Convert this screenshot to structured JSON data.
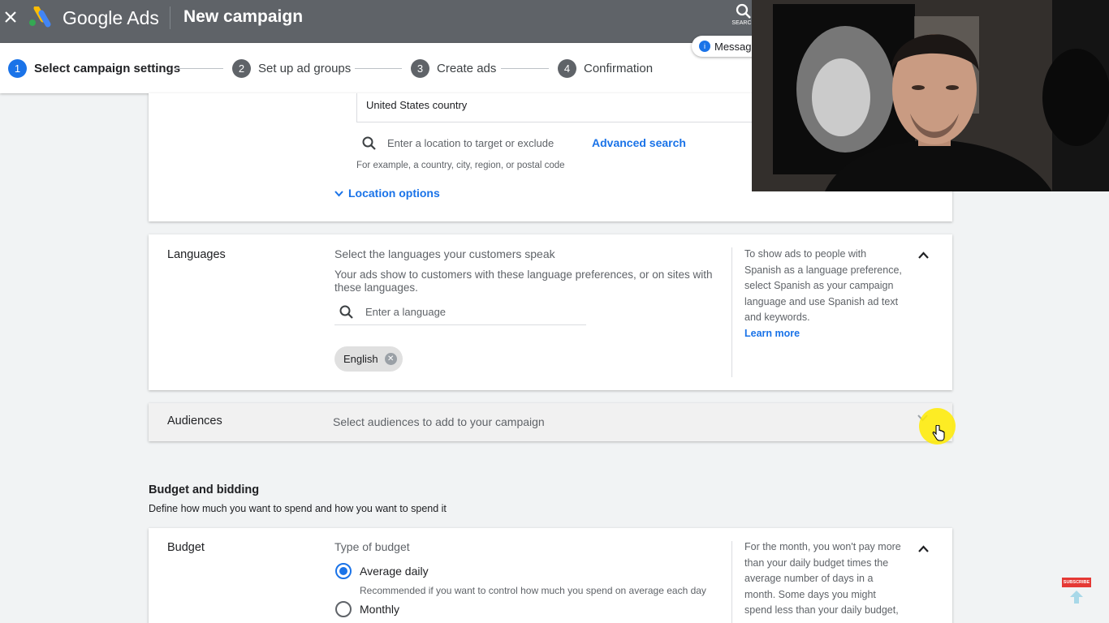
{
  "header": {
    "brand": "Google Ads",
    "page_title": "New campaign",
    "search_label": "SEARCH"
  },
  "stepper": {
    "steps": [
      {
        "num": "1",
        "label": "Select campaign settings",
        "active": true
      },
      {
        "num": "2",
        "label": "Set up ad groups",
        "active": false
      },
      {
        "num": "3",
        "label": "Create ads",
        "active": false
      },
      {
        "num": "4",
        "label": "Confirmation",
        "active": false
      }
    ]
  },
  "messages_pill": {
    "icon_text": "i",
    "label": "Messages"
  },
  "locations": {
    "selected": "United States country",
    "search_placeholder": "Enter a location to target or exclude",
    "advanced_search": "Advanced search",
    "hint": "For example, a country, city, region, or postal code",
    "options_label": "Location options"
  },
  "languages": {
    "label": "Languages",
    "question": "Select the languages your customers speak",
    "description": "Your ads show to customers with these language preferences, or on sites with these languages.",
    "search_placeholder": "Enter a language",
    "chips": [
      "English"
    ],
    "side_text": "To show ads to people with Spanish as a language preference, select Spanish as your campaign language and use Spanish ad text and keywords.",
    "side_link": "Learn more"
  },
  "audiences": {
    "label": "Audiences",
    "text": "Select audiences to add to your campaign"
  },
  "budget_bidding": {
    "title": "Budget and bidding",
    "subtitle": "Define how much you want to spend and how you want to spend it"
  },
  "budget": {
    "label": "Budget",
    "type_label": "Type of budget",
    "options": [
      {
        "label": "Average daily",
        "hint": "Recommended if you want to control how much you spend on average each day",
        "selected": true
      },
      {
        "label": "Monthly",
        "selected": false
      }
    ],
    "side_text": "For the month, you won't pay more than your daily budget times the average number of days in a month. Some days you might spend less than your daily budget,"
  },
  "overlay": {
    "subscribe": "SUBSCRIBE"
  }
}
